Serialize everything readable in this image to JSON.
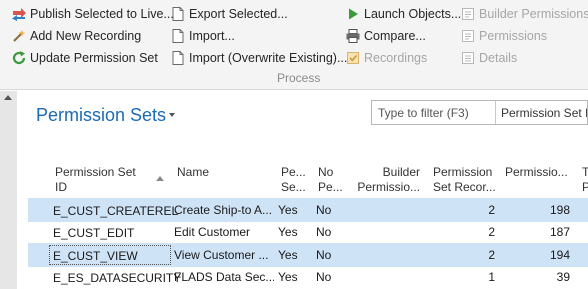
{
  "ribbon": {
    "col1": [
      {
        "label": "Publish Selected to Live...",
        "icon": "publish-icon",
        "enabled": true
      },
      {
        "label": "Add New Recording",
        "icon": "add-recording-icon",
        "enabled": true
      },
      {
        "label": "Update Permission Set",
        "icon": "refresh-icon",
        "enabled": true
      }
    ],
    "col2": [
      {
        "label": "Export Selected...",
        "icon": "export-icon",
        "enabled": true
      },
      {
        "label": "Import...",
        "icon": "import-icon",
        "enabled": true
      },
      {
        "label": "Import (Overwrite Existing)...",
        "icon": "import-overwrite-icon",
        "enabled": true
      }
    ],
    "col3": [
      {
        "label": "Launch Objects...",
        "icon": "play-icon",
        "enabled": true
      },
      {
        "label": "Compare...",
        "icon": "printer-icon",
        "enabled": true
      },
      {
        "label": "Recordings",
        "icon": "recordings-icon",
        "enabled": false
      }
    ],
    "col4": [
      {
        "label": "Builder Permissions",
        "icon": "builder-icon",
        "enabled": false
      },
      {
        "label": "Permissions",
        "icon": "permissions-icon",
        "enabled": false
      },
      {
        "label": "Details",
        "icon": "details-icon",
        "enabled": false
      }
    ],
    "group_label": "Process"
  },
  "page": {
    "title": "Permission Sets",
    "filter_placeholder": "Type to filter (F3)",
    "filter_field": "Permission Set ID"
  },
  "columns": [
    {
      "line1": "Permission Set",
      "line2": "ID"
    },
    {
      "line1": "Name",
      "line2": ""
    },
    {
      "line1": "Pe...",
      "line2": "Se..."
    },
    {
      "line1": "No",
      "line2": "Pe..."
    },
    {
      "line1": "Builder",
      "line2": "Permissio..."
    },
    {
      "line1": "Permission",
      "line2": "Set Recor..."
    },
    {
      "line1": "Permissio...",
      "line2": ""
    },
    {
      "line1": "T",
      "line2": "P"
    }
  ],
  "rows": [
    {
      "id": "E_CUST_CREATEREL",
      "name": "Create Ship-to A...",
      "pe": "Yes",
      "no": "No",
      "builder": "",
      "set_records": "2",
      "permissions": "198",
      "selected": true,
      "focused": false
    },
    {
      "id": "E_CUST_EDIT",
      "name": "Edit Customer",
      "pe": "Yes",
      "no": "No",
      "builder": "",
      "set_records": "2",
      "permissions": "187",
      "selected": false,
      "focused": false
    },
    {
      "id": "E_CUST_VIEW",
      "name": "View Customer ...",
      "pe": "Yes",
      "no": "No",
      "builder": "",
      "set_records": "2",
      "permissions": "194",
      "selected": true,
      "focused": true
    },
    {
      "id": "E_ES_DATASECURITY",
      "name": "FLADS Data Sec...",
      "pe": "Yes",
      "no": "No",
      "builder": "",
      "set_records": "1",
      "permissions": "39",
      "selected": false,
      "focused": false
    }
  ]
}
